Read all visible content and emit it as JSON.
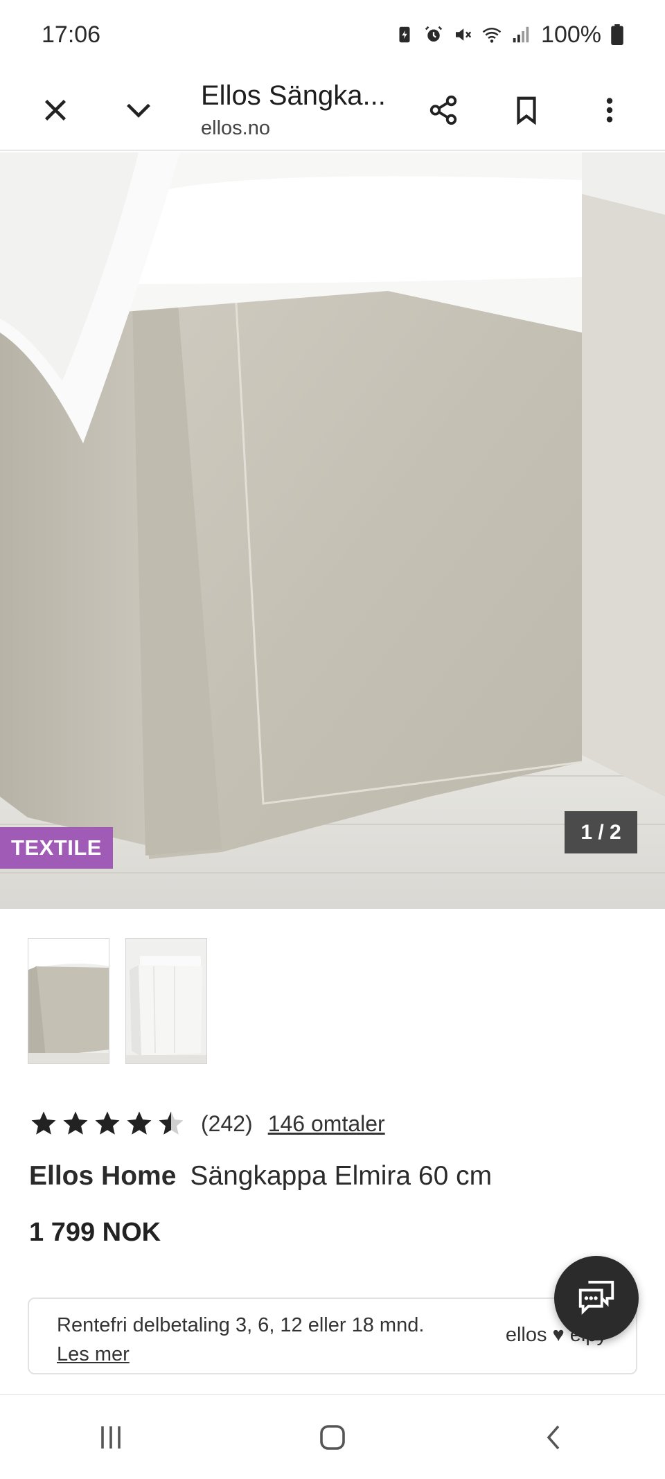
{
  "status_bar": {
    "time": "17:06",
    "battery": "100%",
    "icons": [
      "battery-saver-icon",
      "alarm-icon",
      "mute-icon",
      "wifi-icon",
      "signal-icon",
      "battery-icon"
    ]
  },
  "browser": {
    "tab_title": "Ellos Sängka...",
    "domain": "ellos.no",
    "icons": [
      "close-icon",
      "chevron-down-icon",
      "share-icon",
      "bookmark-icon",
      "more-vertical-icon"
    ]
  },
  "gallery": {
    "badge": "TEXTILE",
    "pager": "1 / 2",
    "current_image": 1,
    "total_images": 2,
    "thumbnails": [
      "thumbnail-linen-bedskirt",
      "thumbnail-white-bedskirt"
    ]
  },
  "product": {
    "rating": 4.5,
    "rating_count": "(242)",
    "reviews_link": "146 omtaler",
    "brand": "Ellos Home",
    "name": "Sängkappa Elmira 60 cm",
    "price": "1 799 NOK"
  },
  "financing": {
    "text": "Rentefri delbetaling 3, 6, 12 eller 18 mnd.",
    "link": "Les mer",
    "logo_text": "ellos ♥ elpy"
  },
  "colors": {
    "badge": "#a05bb6",
    "pager_bg": "#4b4b4b",
    "chat_fab": "#2b2b2b"
  },
  "nav": {
    "icons": [
      "recent-apps-icon",
      "home-icon",
      "back-icon"
    ]
  }
}
